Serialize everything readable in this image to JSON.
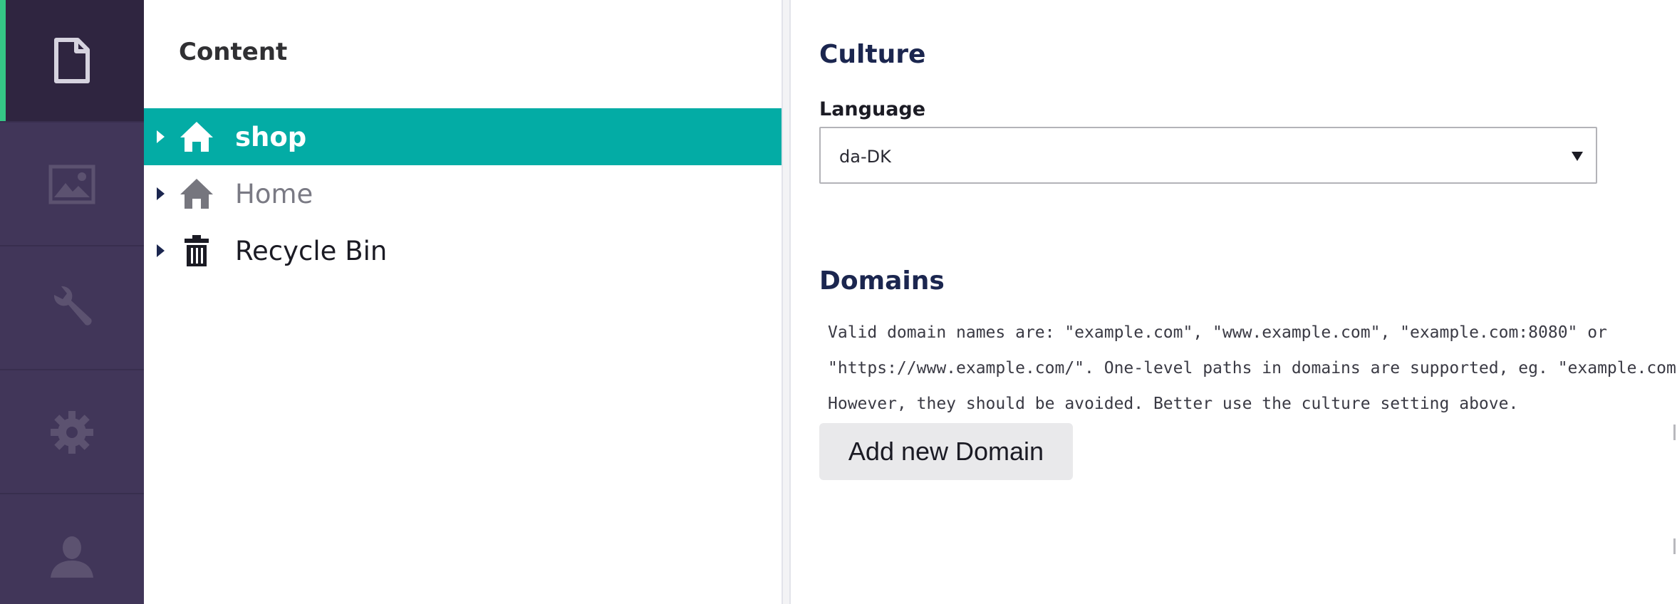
{
  "nav": {
    "items": [
      {
        "icon": "document-icon",
        "active": true
      },
      {
        "icon": "image-icon",
        "active": false
      },
      {
        "icon": "wrench-icon",
        "active": false
      },
      {
        "icon": "gear-icon",
        "active": false
      },
      {
        "icon": "user-icon",
        "active": false
      }
    ]
  },
  "tree": {
    "header": "Content",
    "items": [
      {
        "label": "shop",
        "icon": "home-icon",
        "selected": true
      },
      {
        "label": "Home",
        "icon": "home-icon",
        "selected": false
      },
      {
        "label": "Recycle Bin",
        "icon": "trash-icon",
        "selected": false
      }
    ]
  },
  "culture": {
    "title": "Culture",
    "language_label": "Language",
    "language_value": "da-DK"
  },
  "domains": {
    "title": "Domains",
    "help_lines": [
      "Valid domain names are: \"example.com\", \"www.example.com\", \"example.com:8080\" or",
      "\"https://www.example.com/\". One-level paths in domains are supported, eg. \"example.com/en\".",
      "However, they should be avoided. Better use the culture setting above."
    ],
    "add_button": "Add new Domain"
  },
  "colors": {
    "rail_bg": "#413659",
    "rail_active_bg": "#2f2540",
    "rail_icon": "#5c5270",
    "active_accent": "#35c786",
    "selected_row": "#03aca5"
  }
}
